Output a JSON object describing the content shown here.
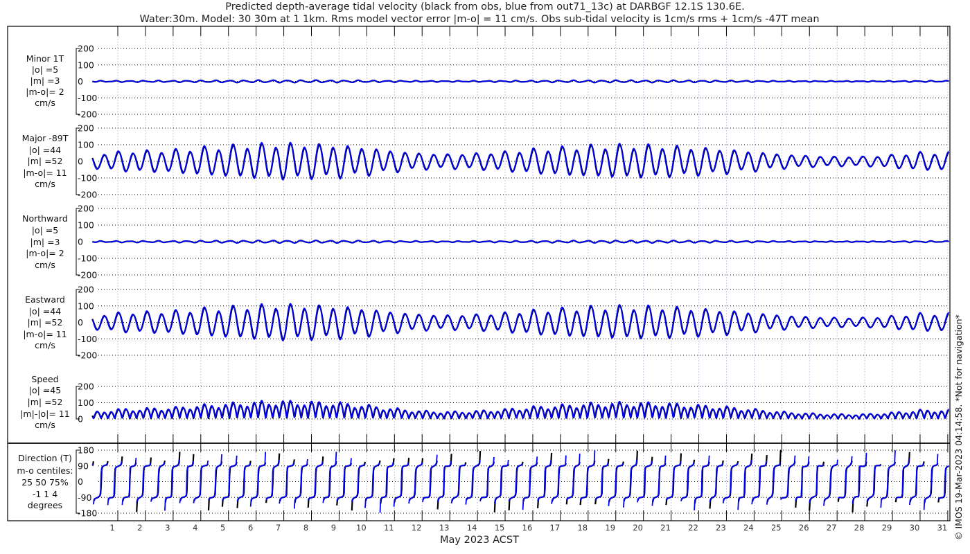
{
  "chart_data": {
    "type": "line",
    "title": [
      "Predicted depth-average tidal velocity (black from obs, blue from out71_13c) at DARBGF 12.1S 130.6E.",
      "Water:30m. Model: 30 30m at 1 1km. Rms model vector error |m-o| = 11 cm/s. Obs sub-tidal velocity is 1cm/s rms + 1cm/s -47T mean"
    ],
    "xlabel": "May 2023 ACST",
    "x_ticks": [
      "1",
      "2",
      "3",
      "4",
      "5",
      "6",
      "7",
      "8",
      "9",
      "10",
      "11",
      "12",
      "13",
      "14",
      "15",
      "16",
      "17",
      "18",
      "19",
      "20",
      "21",
      "22",
      "23",
      "24",
      "25",
      "26",
      "27",
      "28",
      "29",
      "30",
      "31"
    ],
    "xlim_days": [
      0.08,
      31.05
    ],
    "series_legend": {
      "obs": "black",
      "model": "blue"
    },
    "colors": {
      "obs": "#000000",
      "model": "#0000ff",
      "grid": "#000000",
      "day_grid": "#c8c8e6"
    },
    "major_daily_peak_cm_s": [
      40,
      60,
      65,
      70,
      85,
      95,
      105,
      110,
      105,
      100,
      85,
      65,
      50,
      45,
      50,
      60,
      75,
      85,
      95,
      100,
      100,
      95,
      85,
      75,
      60,
      45,
      35,
      30,
      30,
      40,
      55,
      55
    ],
    "semidiurnal_period_days": 0.5175,
    "model_amplitude_ratio": 1.08,
    "panels": [
      {
        "id": "minor",
        "label": [
          "Minor 1T",
          "|o| =5",
          "|m| =3",
          "|m-o|= 2",
          "cm/s"
        ],
        "ylim": [
          -200,
          200
        ],
        "yticks": [
          200,
          100,
          0,
          -100,
          -200
        ]
      },
      {
        "id": "major",
        "label": [
          "Major -89T",
          "|o| =44",
          "|m| =52",
          "|m-o|= 11",
          "cm/s"
        ],
        "ylim": [
          -200,
          200
        ],
        "yticks": [
          200,
          100,
          0,
          -100,
          -200
        ]
      },
      {
        "id": "north",
        "label": [
          "Northward",
          "|o| =5",
          "|m| =3",
          "|m-o|= 2",
          "cm/s"
        ],
        "ylim": [
          -200,
          200
        ],
        "yticks": [
          200,
          100,
          0,
          -100,
          -200
        ]
      },
      {
        "id": "east",
        "label": [
          "Eastward",
          "|o| =44",
          "|m| =52",
          "|m-o|= 11",
          "cm/s"
        ],
        "ylim": [
          -200,
          200
        ],
        "yticks": [
          200,
          100,
          0,
          -100,
          -200
        ]
      },
      {
        "id": "speed",
        "label": [
          "Speed",
          "|o| =45",
          "|m| =52",
          "|m|-|o|= 11",
          "cm/s"
        ],
        "ylim": [
          0,
          200
        ],
        "yticks": [
          200,
          100,
          0
        ]
      },
      {
        "id": "direction",
        "label": [
          "Direction (T)",
          "m-o centiles:",
          "25  50  75%",
          "-1  1  4",
          "degrees"
        ],
        "ylim": [
          -180,
          180
        ],
        "yticks": [
          180,
          90,
          0,
          -90,
          -180
        ]
      }
    ]
  },
  "credit": "© IMOS 19-Mar-2023 04:14:58. *Not for navigation*"
}
